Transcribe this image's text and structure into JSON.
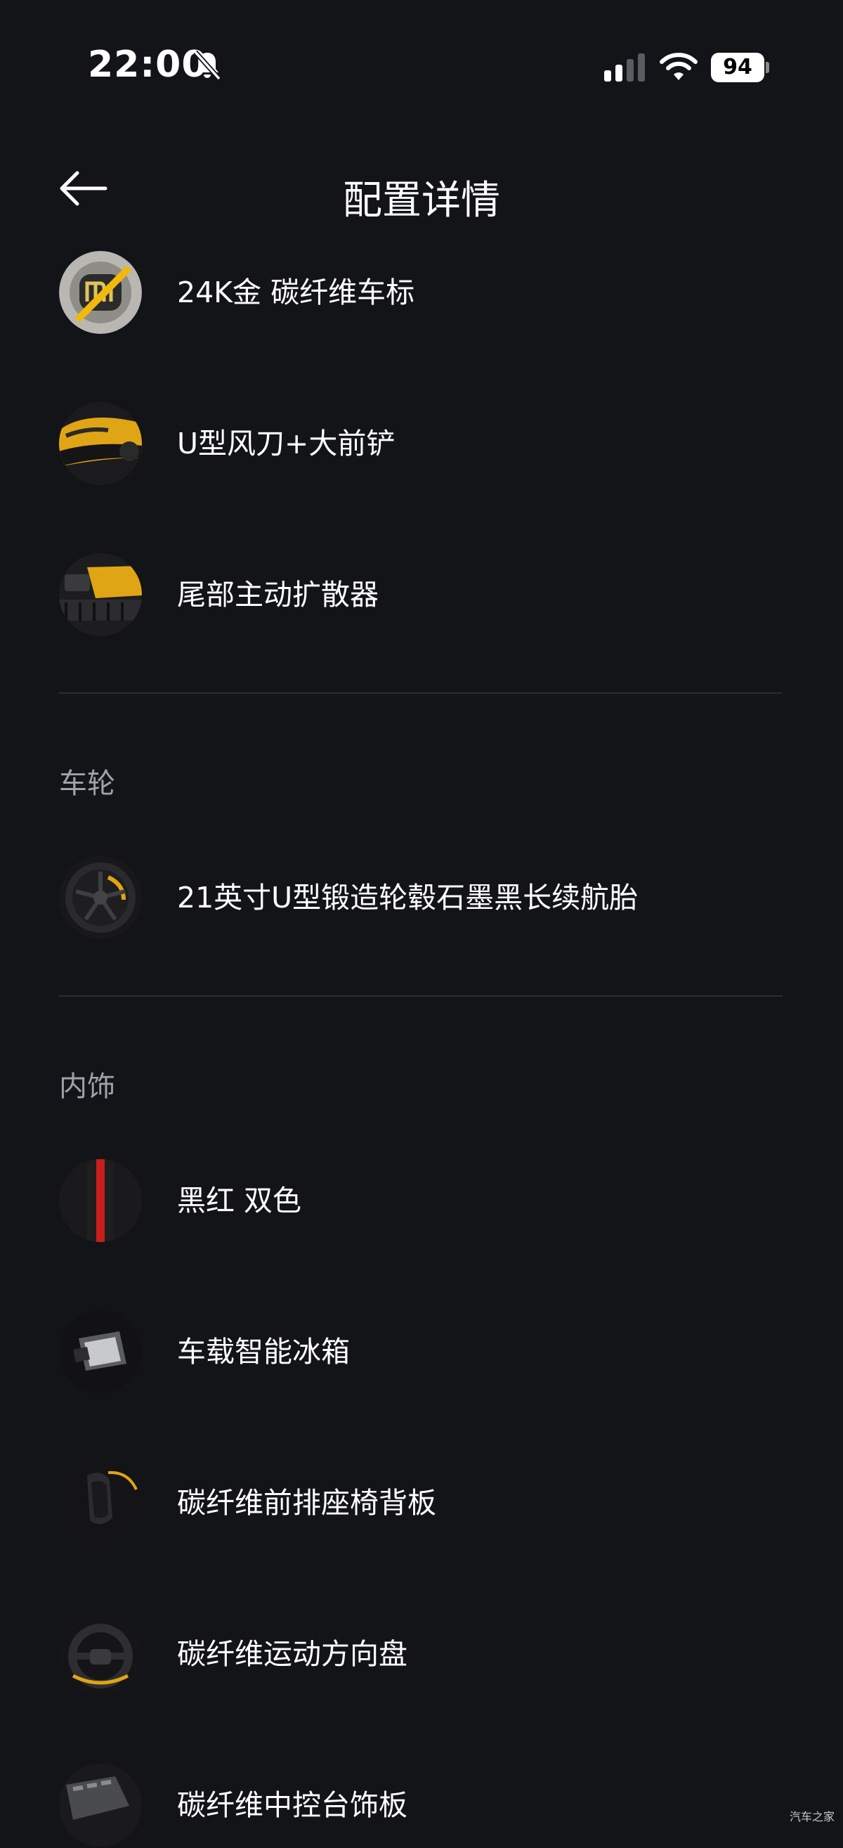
{
  "status_bar": {
    "time": "22:00",
    "battery": "94"
  },
  "header": {
    "title": "配置详情"
  },
  "items_top": [
    {
      "label": "24K金 碳纤维车标",
      "icon": "logo-badge"
    },
    {
      "label": "U型风刀+大前铲",
      "icon": "front-bumper"
    },
    {
      "label": "尾部主动扩散器",
      "icon": "rear-diffuser"
    }
  ],
  "wheels": {
    "title": "车轮",
    "items": [
      {
        "label": "21英寸U型锻造轮毂石墨黑长续航胎",
        "icon": "wheel"
      }
    ]
  },
  "interior": {
    "title": "内饰",
    "items": [
      {
        "label": "黑红 双色",
        "icon": "color-swatch"
      },
      {
        "label": "车载智能冰箱",
        "icon": "fridge"
      },
      {
        "label": "碳纤维前排座椅背板",
        "icon": "seat"
      },
      {
        "label": "碳纤维运动方向盘",
        "icon": "steering-wheel"
      },
      {
        "label": "碳纤维中控台饰板",
        "icon": "console-trim"
      }
    ]
  },
  "watermark": "汽车之家",
  "colors": {
    "background": "#131418",
    "text": "#ffffff",
    "section_header": "#9ea2ab",
    "divider": "#2a2c31",
    "accent_yellow": "#f0b90b"
  }
}
